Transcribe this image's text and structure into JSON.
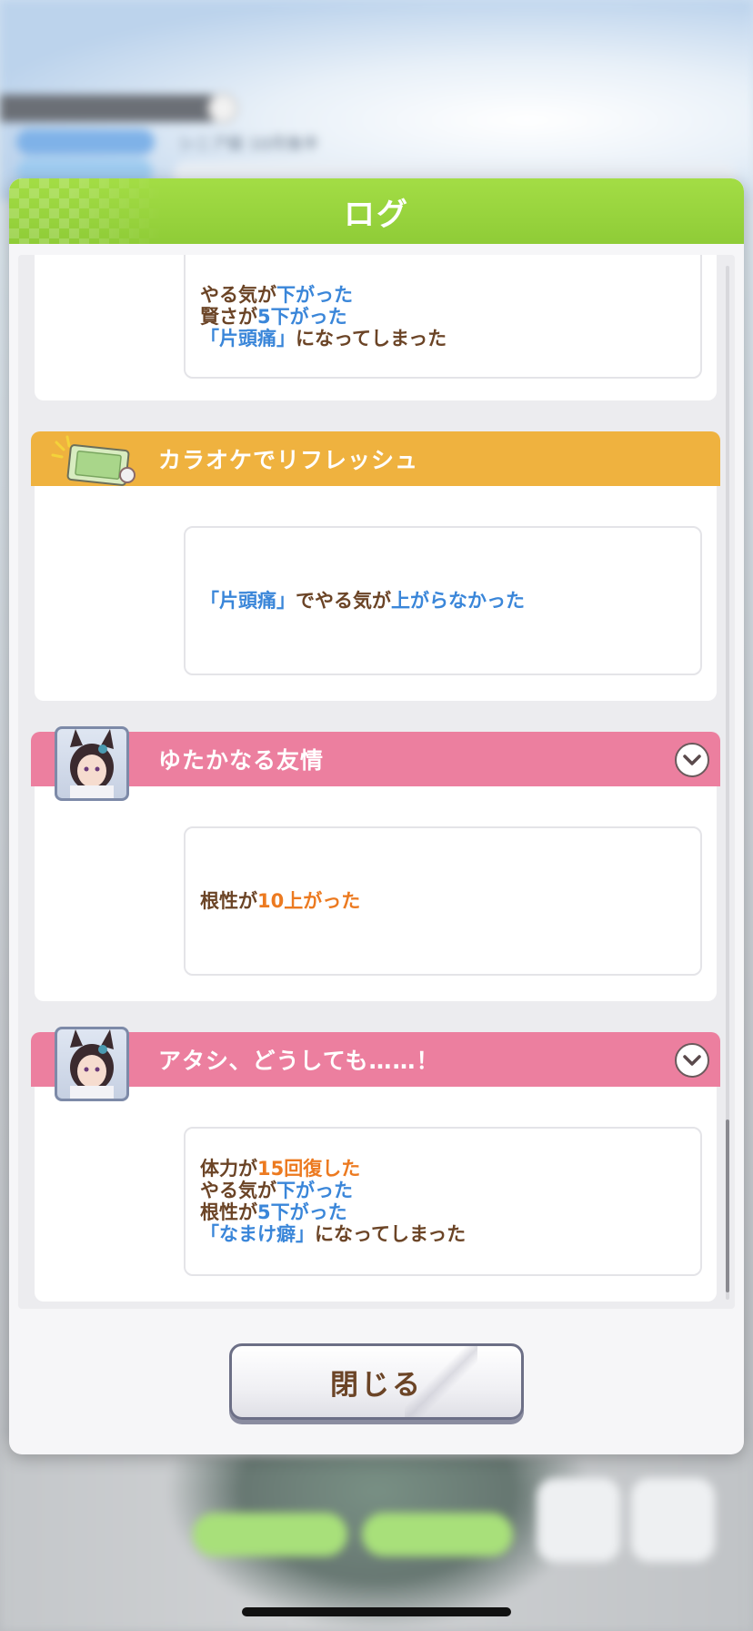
{
  "background": {
    "trainee_name": "",
    "turn_text": "シニア級 10月後半"
  },
  "dialog": {
    "title": "ログ",
    "close_label": "閉じる"
  },
  "entries": [
    {
      "title": "",
      "lines": [
        [
          {
            "t": "やる気が",
            "c": "brown"
          },
          {
            "t": "下がった",
            "c": "blue"
          }
        ],
        [
          {
            "t": "賢さが",
            "c": "brown"
          },
          {
            "t": "5下がった",
            "c": "blue"
          }
        ],
        [
          {
            "t": "「片頭痛」",
            "c": "blue"
          },
          {
            "t": "になってしまった",
            "c": "brown"
          }
        ]
      ]
    },
    {
      "title": "カラオケでリフレッシュ",
      "icon": "karaoke-ticket-icon",
      "header_color": "#efb23f",
      "lines": [
        [
          {
            "t": "「片頭痛」",
            "c": "blue"
          },
          {
            "t": "でやる気が",
            "c": "brown"
          },
          {
            "t": "上がらなかった",
            "c": "blue"
          }
        ]
      ]
    },
    {
      "title": "ゆたかなる友情",
      "icon": "character-portrait",
      "header_color": "#ec7f9f",
      "lines": [
        [
          {
            "t": "根性が",
            "c": "brown"
          },
          {
            "t": "10上がった",
            "c": "orange"
          }
        ]
      ]
    },
    {
      "title": "アタシ、どうしても……！",
      "icon": "character-portrait",
      "header_color": "#ec7f9f",
      "lines": [
        [
          {
            "t": "体力が",
            "c": "brown"
          },
          {
            "t": "15回復した",
            "c": "orange"
          }
        ],
        [
          {
            "t": "やる気が",
            "c": "brown"
          },
          {
            "t": "下がった",
            "c": "blue"
          }
        ],
        [
          {
            "t": "根性が",
            "c": "brown"
          },
          {
            "t": "5下がった",
            "c": "blue"
          }
        ],
        [
          {
            "t": "「なまけ癖」",
            "c": "blue"
          },
          {
            "t": "になってしまった",
            "c": "brown"
          }
        ]
      ]
    }
  ],
  "colors": {
    "header_green": "#97d13c",
    "orange_header": "#efb23f",
    "pink_header": "#ec7f9f",
    "text_brown": "#6b4426",
    "text_blue": "#3a86d9",
    "text_orange": "#ec7a20"
  }
}
